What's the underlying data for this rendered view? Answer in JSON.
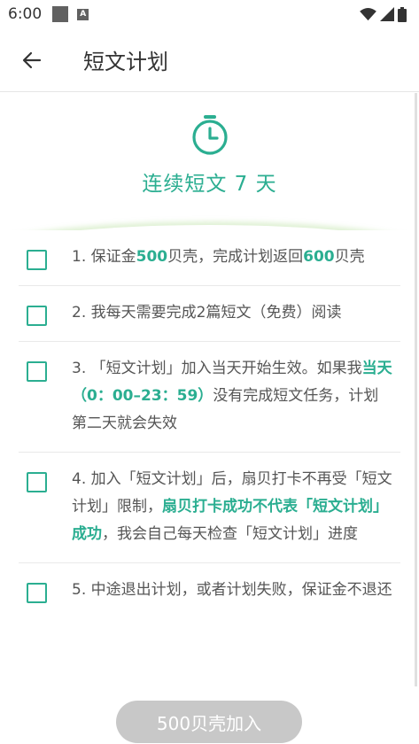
{
  "status_bar": {
    "time": "6:00",
    "icon_a": "A"
  },
  "toolbar": {
    "title": "短文计划"
  },
  "header": {
    "plan_title": "连续短文 7 天",
    "accent_color": "#2bae91"
  },
  "rules": [
    {
      "checked": false,
      "parts": [
        {
          "text": "1. 保证金",
          "highlight": false
        },
        {
          "text": "500",
          "highlight": true
        },
        {
          "text": "贝壳，完成计划返回",
          "highlight": false
        },
        {
          "text": "600",
          "highlight": true
        },
        {
          "text": "贝壳",
          "highlight": false
        }
      ]
    },
    {
      "checked": false,
      "parts": [
        {
          "text": "2. 我每天需要完成2篇短文（免费）阅读",
          "highlight": false
        }
      ]
    },
    {
      "checked": false,
      "parts": [
        {
          "text": "3. 「短文计划」加入当天开始生效。如果我",
          "highlight": false
        },
        {
          "text": "当天（0：00–23：59）",
          "highlight": true
        },
        {
          "text": "没有完成短文任务，计划第二天就会失效",
          "highlight": false
        }
      ]
    },
    {
      "checked": false,
      "parts": [
        {
          "text": "4. 加入「短文计划」后，扇贝打卡不再受「短文计划」限制，",
          "highlight": false
        },
        {
          "text": "扇贝打卡成功不代表「短文计划」成功",
          "highlight": true
        },
        {
          "text": "，我会自己每天检查「短文计划」进度",
          "highlight": false
        }
      ]
    },
    {
      "checked": false,
      "parts": [
        {
          "text": "5. 中途退出计划，或者计划失败，保证金不退还",
          "highlight": false
        }
      ]
    }
  ],
  "join_button": {
    "label": "500贝壳加入",
    "enabled": false
  }
}
